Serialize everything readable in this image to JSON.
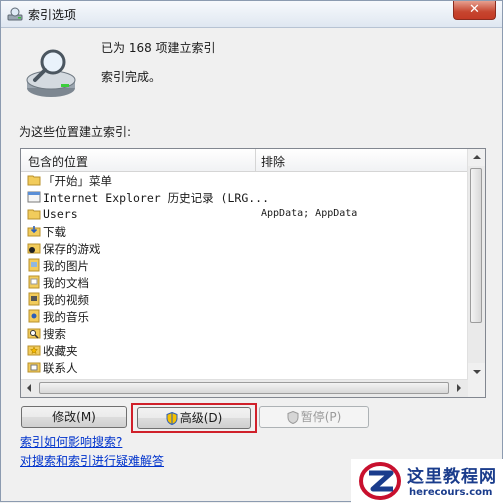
{
  "window": {
    "title": "索引选项",
    "close_glyph": "✕"
  },
  "summary": {
    "count_text": "已为 168 项建立索引",
    "status_text": "索引完成。"
  },
  "locations_label": "为这些位置建立索引:",
  "table": {
    "col_included": "包含的位置",
    "col_excluded": "排除",
    "rows": [
      {
        "name": "「开始」菜单",
        "excluded": "",
        "icon": "folder-icon"
      },
      {
        "name": "Internet Explorer 历史记录 (LRG...",
        "excluded": "",
        "icon": "ie-history-icon"
      },
      {
        "name": "Users",
        "excluded": "AppData; AppData",
        "icon": "folder-icon"
      },
      {
        "name": "下载",
        "excluded": "",
        "icon": "downloads-icon"
      },
      {
        "name": "保存的游戏",
        "excluded": "",
        "icon": "saved-games-icon"
      },
      {
        "name": "我的图片",
        "excluded": "",
        "icon": "library-icon"
      },
      {
        "name": "我的文档",
        "excluded": "",
        "icon": "library-icon"
      },
      {
        "name": "我的视频",
        "excluded": "",
        "icon": "library-icon"
      },
      {
        "name": "我的音乐",
        "excluded": "",
        "icon": "library-icon"
      },
      {
        "name": "搜索",
        "excluded": "",
        "icon": "searches-icon"
      },
      {
        "name": "收藏夹",
        "excluded": "",
        "icon": "favorites-icon"
      },
      {
        "name": "联系人",
        "excluded": "",
        "icon": "contacts-icon"
      }
    ]
  },
  "buttons": {
    "modify": "修改(M)",
    "advanced": "高级(D)",
    "pause": "暂停(P)"
  },
  "links": {
    "how_affects": "索引如何影响搜索?",
    "troubleshoot": "对搜索和索引进行疑难解答"
  },
  "watermark": {
    "title": "这里教程网",
    "url": "herecours.com"
  },
  "colors": {
    "link": "#0033cc",
    "highlight": "#d0202a",
    "accent": "#1a3c8c"
  }
}
